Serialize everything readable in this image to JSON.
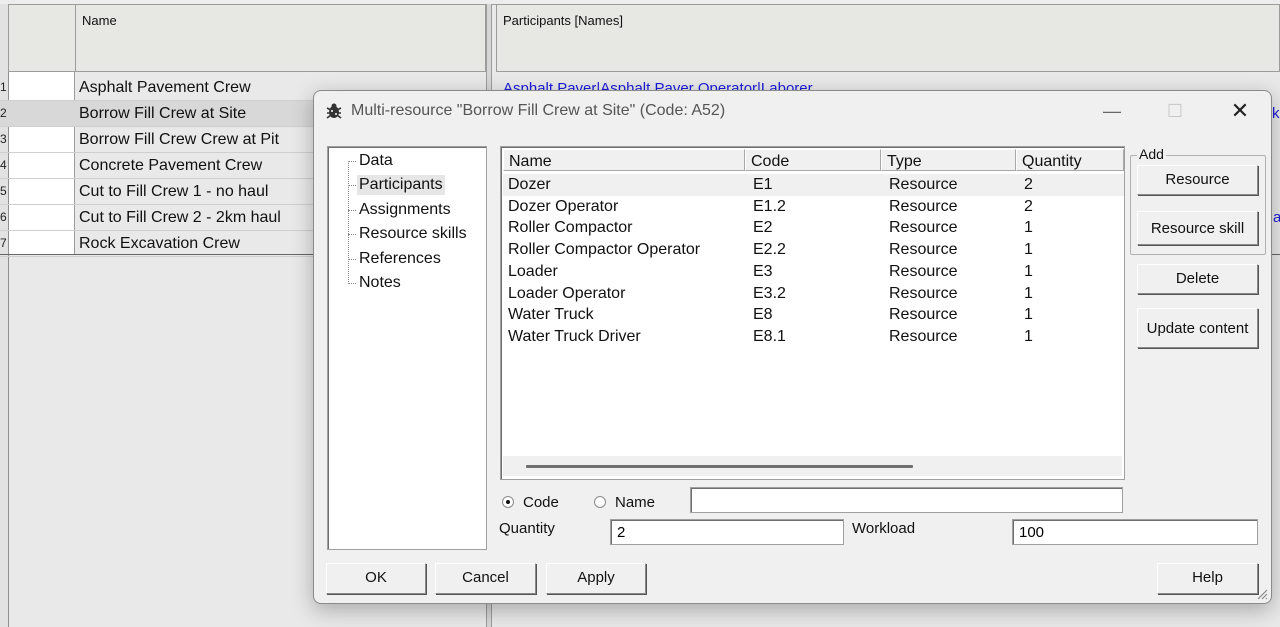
{
  "background": {
    "headers": {
      "name": "Name",
      "participants": "Participants [Names]"
    },
    "row_numbers": [
      "1",
      "2",
      "3",
      "4",
      "5",
      "6",
      "7"
    ],
    "rows": [
      "Asphalt Pavement Crew",
      "Borrow Fill Crew at Site",
      "Borrow Fill Crew Crew at Pit",
      "Concrete Pavement Crew",
      "Cut to Fill Crew 1 - no haul",
      "Cut to Fill Crew 2 -  2km haul",
      "Rock Excavation Crew"
    ],
    "selected_row": 1,
    "participants_first_row": "Asphalt Paver|Asphalt Paver Operator|Laborer",
    "edge_fragment_1": "k|",
    "edge_fragment_2": "a"
  },
  "dialog": {
    "title": "Multi-resource \"Borrow Fill Crew at Site\" (Code: A52)",
    "controls": {
      "minimize": "—",
      "maximize": "☐",
      "close": "✕"
    },
    "tree": {
      "items": [
        "Data",
        "Participants",
        "Assignments",
        "Resource skills",
        "References",
        "Notes"
      ],
      "selected": "Participants"
    },
    "table": {
      "columns": [
        "Name",
        "Code",
        "Type",
        "Quantity"
      ],
      "rows": [
        [
          "Dozer",
          "E1",
          "Resource",
          "2"
        ],
        [
          "Dozer Operator",
          "E1.2",
          "Resource",
          "2"
        ],
        [
          "Roller Compactor",
          "E2",
          "Resource",
          "1"
        ],
        [
          "Roller Compactor Operator",
          "E2.2",
          "Resource",
          "1"
        ],
        [
          "Loader",
          "E3",
          "Resource",
          "1"
        ],
        [
          "Loader Operator",
          "E3.2",
          "Resource",
          "1"
        ],
        [
          "Water Truck",
          "E8",
          "Resource",
          "1"
        ],
        [
          "Water Truck Driver",
          "E8.1",
          "Resource",
          "1"
        ]
      ],
      "selected_row": 0
    },
    "add_group": {
      "label": "Add",
      "resource": "Resource",
      "resource_skill": "Resource skill"
    },
    "delete": "Delete",
    "update_content": "Update content",
    "search": {
      "code_label": "Code",
      "name_label": "Name",
      "selected": "Code",
      "value": ""
    },
    "quantity": {
      "label": "Quantity",
      "value": "2"
    },
    "workload": {
      "label": "Workload",
      "value": "100"
    },
    "buttons": {
      "ok": "OK",
      "cancel": "Cancel",
      "apply": "Apply",
      "help": "Help"
    }
  }
}
